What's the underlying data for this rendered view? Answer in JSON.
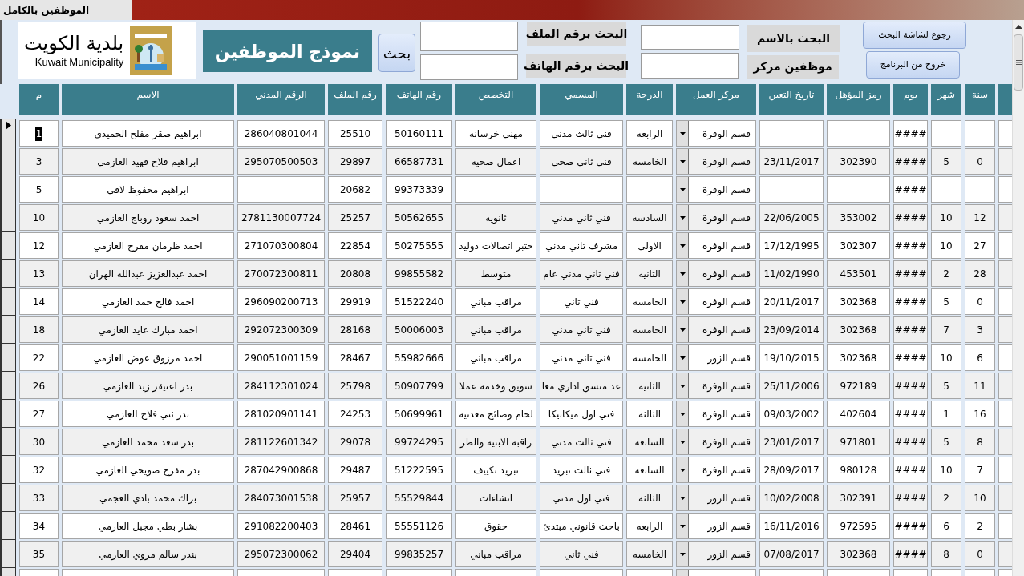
{
  "window": {
    "title": "الموظفين بالكامل"
  },
  "header": {
    "logo": {
      "arabic": "بلدية الكويت",
      "english": "Kuwait Municipality"
    },
    "form_title": "نموذج الموظفين",
    "search_button": "بحث",
    "search_fields": [
      {
        "label": "البحث بالاسم"
      },
      {
        "label": "البحث برقم الملف"
      },
      {
        "label": "موظفين مركز"
      },
      {
        "label": "البحث برقم الهاتف"
      }
    ],
    "buttons": [
      "رجوع لشاشة البحث",
      "خروج من البرنامج"
    ]
  },
  "table": {
    "columns": [
      {
        "label": "سنة",
        "kind": "text"
      },
      {
        "label": "شهر",
        "kind": "text"
      },
      {
        "label": "يوم",
        "kind": "text"
      },
      {
        "label": "رمز المؤهل",
        "kind": "text"
      },
      {
        "label": "تاريخ التعين",
        "kind": "text"
      },
      {
        "label": "مركز العمل",
        "kind": "combo"
      },
      {
        "label": "الدرجة",
        "kind": "text"
      },
      {
        "label": "المسمي",
        "kind": "text"
      },
      {
        "label": "التخصص",
        "kind": "text"
      },
      {
        "label": "رقم الهاتف",
        "kind": "text"
      },
      {
        "label": "رقم الملف",
        "kind": "text"
      },
      {
        "label": "الرقم المدني",
        "kind": "text"
      },
      {
        "label": "الاسم",
        "kind": "text"
      },
      {
        "label": "م",
        "kind": "text"
      }
    ],
    "rows": [
      {
        "selected": true,
        "cells": [
          null,
          null,
          "####",
          null,
          null,
          "قسم الوفرة",
          "الرابعه",
          "فني ثالث مدني",
          "مهني خرسانه",
          "50160111",
          "25510",
          "286040801044",
          "ابراهيم صقر مفلح الحميدي",
          "1"
        ]
      },
      {
        "selected": false,
        "cells": [
          "0",
          "5",
          "####",
          "302390",
          "23/11/2017",
          "قسم الوفرة",
          "الخامسه",
          "فني ثاني صحي",
          "اعمال صحيه",
          "66587731",
          "29897",
          "295070500503",
          "ابراهيم فلاح فهيد العازمي",
          "3"
        ]
      },
      {
        "selected": false,
        "cells": [
          null,
          null,
          "####",
          null,
          null,
          "قسم الوفرة",
          null,
          null,
          null,
          "99373339",
          "20682",
          null,
          "ابراهيم محفوظ لافى",
          "5"
        ]
      },
      {
        "selected": false,
        "cells": [
          "12",
          "10",
          "####",
          "353002",
          "22/06/2005",
          "قسم الوفرة",
          "السادسه",
          "فني ثاني مدني",
          "ثانويه",
          "50562655",
          "25257",
          "2781130007724",
          "احمد سعود روباج العازمي",
          "10"
        ]
      },
      {
        "selected": false,
        "cells": [
          "27",
          "10",
          "####",
          "302307",
          "17/12/1995",
          "قسم الوفرة",
          "الاولى",
          "مشرف ثاني مدني",
          "ختبر اتصالات دوليد",
          "50275555",
          "22854",
          "271070300804",
          "احمد ظرمان مفرح العازمي",
          "12"
        ]
      },
      {
        "selected": false,
        "cells": [
          "28",
          "2",
          "####",
          "453501",
          "11/02/1990",
          "قسم الوفرة",
          "الثانيه",
          "فني ثاني مدني عام",
          "متوسط",
          "99855582",
          "20808",
          "270072300811",
          "احمد عبدالعزيز عبدالله الهران",
          "13"
        ]
      },
      {
        "selected": false,
        "cells": [
          "0",
          "5",
          "####",
          "302368",
          "20/11/2017",
          "قسم الوفرة",
          "الخامسه",
          "فني ثاني",
          "مراقب مباني",
          "51522240",
          "29919",
          "296090200713",
          "احمد فالح حمد العازمي",
          "14"
        ]
      },
      {
        "selected": false,
        "cells": [
          "3",
          "7",
          "####",
          "302368",
          "23/09/2014",
          "قسم الوفرة",
          "الخامسه",
          "فني ثاني مدني",
          "مراقب مباني",
          "50006003",
          "28168",
          "292072300309",
          "احمد مبارك عايد العازمي",
          "18"
        ]
      },
      {
        "selected": false,
        "cells": [
          "6",
          "10",
          "####",
          "302368",
          "19/10/2015",
          "قسم الزور",
          "الخامسه",
          "فني ثاني مدني",
          "مراقب مباني",
          "55982666",
          "28467",
          "290051001159",
          "احمد مرزوق عوض العازمي",
          "22"
        ]
      },
      {
        "selected": false,
        "cells": [
          "11",
          "5",
          "####",
          "972189",
          "25/11/2006",
          "قسم الوفرة",
          "الثانيه",
          "عد منسق اداري معا",
          "سويق وخدمه عملا",
          "50907799",
          "25798",
          "284112301024",
          "بدر اعنيقز زيد العازمي",
          "26"
        ]
      },
      {
        "selected": false,
        "cells": [
          "16",
          "1",
          "####",
          "402604",
          "09/03/2002",
          "قسم الوفرة",
          "الثالثه",
          "فني اول ميكانيكا",
          "لحام وصائح معدنيه",
          "50699961",
          "24253",
          "281020901141",
          "بدر ثني فلاح العازمي",
          "27"
        ]
      },
      {
        "selected": false,
        "cells": [
          "8",
          "5",
          "####",
          "971801",
          "23/01/2017",
          "قسم الوفرة",
          "السابعه",
          "فني ثالث مدني",
          "راقبه الابنيه والطر",
          "99724295",
          "29078",
          "281122601342",
          "بدر سعد محمد العازمي",
          "30"
        ]
      },
      {
        "selected": false,
        "cells": [
          "7",
          "10",
          "####",
          "980128",
          "28/09/2017",
          "قسم الوفرة",
          "السابعه",
          "فني ثالث تبريد",
          "تبريد تكييف",
          "51222595",
          "29487",
          "287042900868",
          "بدر مفرح ضويحي العازمي",
          "32"
        ]
      },
      {
        "selected": false,
        "cells": [
          "10",
          "2",
          "####",
          "302391",
          "10/02/2008",
          "قسم الزور",
          "الثالثه",
          "فني اول مدني",
          "انشاءات",
          "55529844",
          "25957",
          "284073001538",
          "براك محمد بادي العجمي",
          "33"
        ]
      },
      {
        "selected": false,
        "cells": [
          "2",
          "6",
          "####",
          "972595",
          "16/11/2016",
          "قسم الزور",
          "الرابعه",
          "باحث قانوني مبتدئ",
          "حقوق",
          "55551126",
          "28461",
          "291082200403",
          "بشار بطي مجبل العازمي",
          "34"
        ]
      },
      {
        "selected": false,
        "cells": [
          "0",
          "8",
          "####",
          "302368",
          "07/08/2017",
          "قسم الزور",
          "الخامسه",
          "فني ثاني",
          "مراقب مباني",
          "99835257",
          "29404",
          "295072300062",
          "بندر سالم مروي العازمي",
          "35"
        ]
      }
    ]
  }
}
